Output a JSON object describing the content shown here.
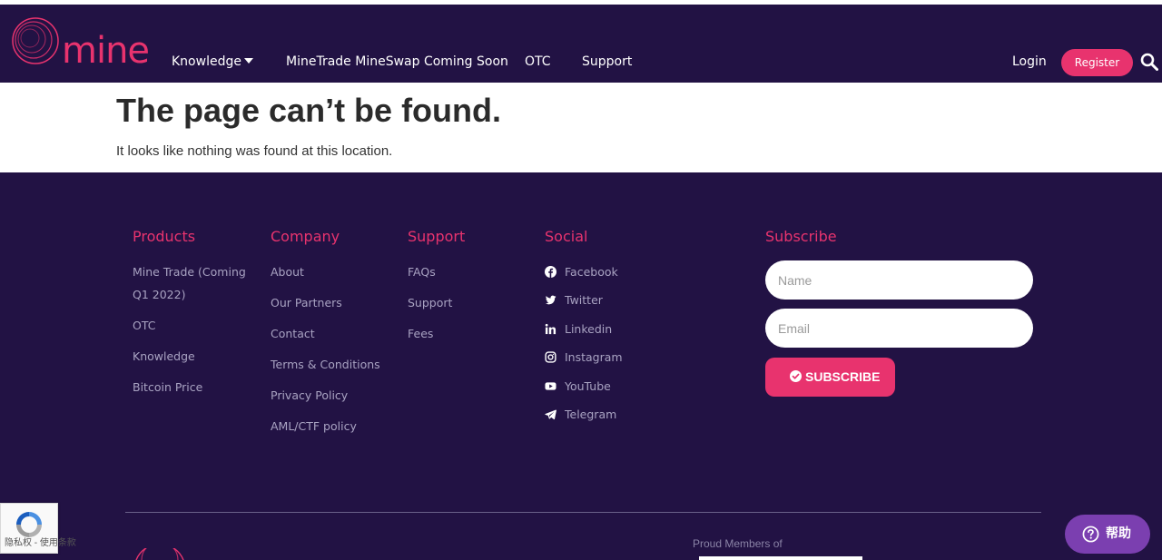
{
  "nav": {
    "logo_text": "mine",
    "items": [
      "Knowledge",
      "MineTrade MineSwap Coming Soon",
      "OTC",
      "Support"
    ],
    "login": "Login",
    "register": "Register"
  },
  "notfound": {
    "title": "The page can’t be found.",
    "text": "It looks like nothing was found at this location."
  },
  "footer": {
    "products": {
      "heading": "Products",
      "links": [
        "Mine Trade (Coming",
        "Q1 2022)",
        "OTC",
        "Knowledge",
        "Bitcoin Price"
      ]
    },
    "company": {
      "heading": "Company",
      "links": [
        "About",
        "Our Partners",
        "Contact",
        "Terms & Conditions",
        "Privacy Policy",
        "AML/CTF policy"
      ]
    },
    "support": {
      "heading": "Support",
      "links": [
        "FAQs",
        "Support",
        "Fees"
      ]
    },
    "social": {
      "heading": "Social",
      "links": [
        "Facebook",
        "Twitter",
        "Linkedin",
        "Instagram",
        "YouTube",
        "Telegram"
      ]
    },
    "subscribe": {
      "heading": "Subscribe",
      "name_placeholder": "Name",
      "email_placeholder": "Email",
      "button": "SUBSCRIBE"
    },
    "proud": "Proud Members of"
  },
  "recaptcha": {
    "text": "隐私权 - 使用条款"
  },
  "help": {
    "label": "帮助"
  },
  "colors": {
    "navy": "#221244",
    "accent": "#e8336e",
    "help": "#7b3fb0"
  }
}
